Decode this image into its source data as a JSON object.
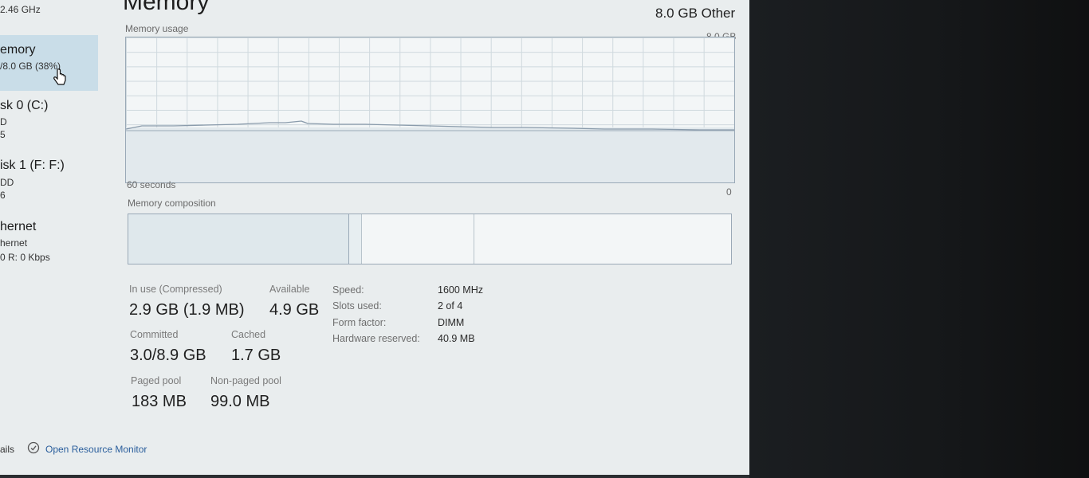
{
  "sidebar": {
    "cpu_speed": "2.46 GHz",
    "items": [
      {
        "name": "emory",
        "detail": "/8.0 GB (38%)"
      },
      {
        "name": "sk 0 (C:)",
        "detail": "D",
        "detail2": "5"
      },
      {
        "name": "isk 1 (F: F:)",
        "detail": "DD",
        "detail2": "6"
      },
      {
        "name": "hernet",
        "detail": "hernet",
        "detail2": "0 R: 0 Kbps"
      }
    ]
  },
  "main": {
    "title": "Memory",
    "subtitle": "8.0 GB Other",
    "graph": {
      "label": "Memory usage",
      "max_label": "8.0 GB",
      "time_label": "60 seconds",
      "min_label": "0",
      "usage_fraction": 0.38
    },
    "composition_label": "Memory composition",
    "stats": {
      "in_use_label": "In use (Compressed)",
      "in_use_value": "2.9 GB (1.9 MB)",
      "available_label": "Available",
      "available_value": "4.9 GB",
      "committed_label": "Committed",
      "committed_value": "3.0/8.9 GB",
      "cached_label": "Cached",
      "cached_value": "1.7 GB",
      "paged_label": "Paged pool",
      "paged_value": "183 MB",
      "nonpaged_label": "Non-paged pool",
      "nonpaged_value": "99.0 MB"
    },
    "specs": [
      {
        "label": "Speed:",
        "value": "1600 MHz"
      },
      {
        "label": "Slots used:",
        "value": "2 of 4"
      },
      {
        "label": "Form factor:",
        "value": "DIMM"
      },
      {
        "label": "Hardware reserved:",
        "value": "40.9 MB"
      }
    ]
  },
  "footer": {
    "details_label": "ails",
    "resource_monitor_label": "Open Resource Monitor"
  },
  "colors": {
    "graph_line": "#8a9bab",
    "composition_in_use": "#dfe8ec",
    "selected_tile": "#c9dde8"
  }
}
